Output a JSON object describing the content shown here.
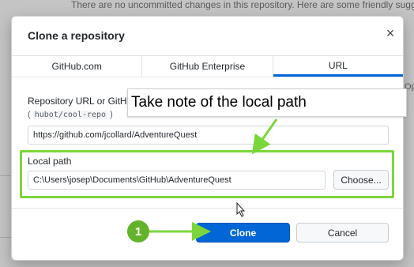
{
  "background": {
    "notice_text": "There are no uncommitted changes in this repository. Here are some friendly sugg",
    "notice_text2": "...",
    "right_fragment": "Op"
  },
  "dialog": {
    "title": "Clone a repository",
    "close_glyph": "×",
    "tabs": [
      {
        "label": "GitHub.com",
        "active": false
      },
      {
        "label": "GitHub Enterprise",
        "active": false
      },
      {
        "label": "URL",
        "active": true
      }
    ],
    "repo_url": {
      "label": "Repository URL or GitHub username and repository",
      "hint_prefix": "(",
      "hint_code": "hubot/cool-repo",
      "hint_suffix": ")",
      "value": "https://github.com/jcollard/AdventureQuest"
    },
    "local_path": {
      "label": "Local path",
      "value": "C:\\Users\\josep\\Documents\\GitHub\\AdventureQuest",
      "choose_label": "Choose..."
    },
    "buttons": {
      "clone": "Clone",
      "cancel": "Cancel"
    }
  },
  "annotations": {
    "callout_text": "Take note of the local path",
    "step_badge": "1",
    "accent_color": "#7bd63b"
  },
  "colors": {
    "primary": "#0366d6",
    "tab_active_underline": "#0366d6"
  }
}
